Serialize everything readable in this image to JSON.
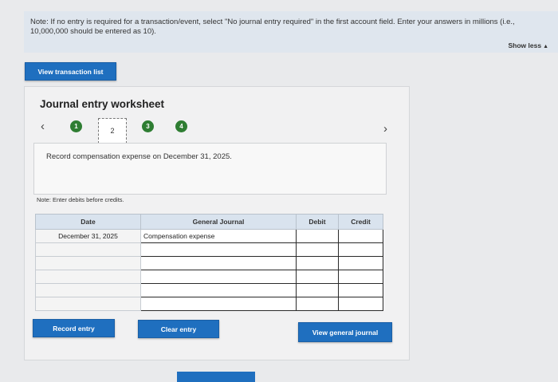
{
  "note": {
    "text": "Note: If no entry is required for a transaction/event, select \"No journal entry required\" in the first account field. Enter your answers in millions (i.e., 10,000,000 should be entered as 10).",
    "show_less_label": "Show less",
    "show_less_icon": "triangle-up-icon"
  },
  "toolbar": {
    "view_transactions_label": "View transaction list"
  },
  "worksheet": {
    "title": "Journal entry worksheet",
    "steps": [
      "1",
      "2",
      "3",
      "4"
    ],
    "current_step": "2",
    "prev_icon": "chevron-left-icon",
    "next_icon": "chevron-right-icon",
    "description": "Record compensation expense on December 31, 2025.",
    "note_debits": "Note: Enter debits before credits.",
    "step_color": "#2e7d32"
  },
  "table": {
    "headers": [
      "Date",
      "General Journal",
      "Debit",
      "Credit"
    ],
    "rows": [
      {
        "date": "December 31, 2025",
        "account": "Compensation expense",
        "debit": "",
        "credit": ""
      },
      {
        "date": "",
        "account": "",
        "debit": "",
        "credit": ""
      },
      {
        "date": "",
        "account": "",
        "debit": "",
        "credit": ""
      },
      {
        "date": "",
        "account": "",
        "debit": "",
        "credit": ""
      },
      {
        "date": "",
        "account": "",
        "debit": "",
        "credit": ""
      },
      {
        "date": "",
        "account": "",
        "debit": "",
        "credit": ""
      }
    ]
  },
  "actions": {
    "record_label": "Record entry",
    "clear_label": "Clear entry",
    "view_journal_label": "View general journal"
  },
  "colors": {
    "accent": "#1f6fbf",
    "header_bg": "#d9e3ee"
  }
}
